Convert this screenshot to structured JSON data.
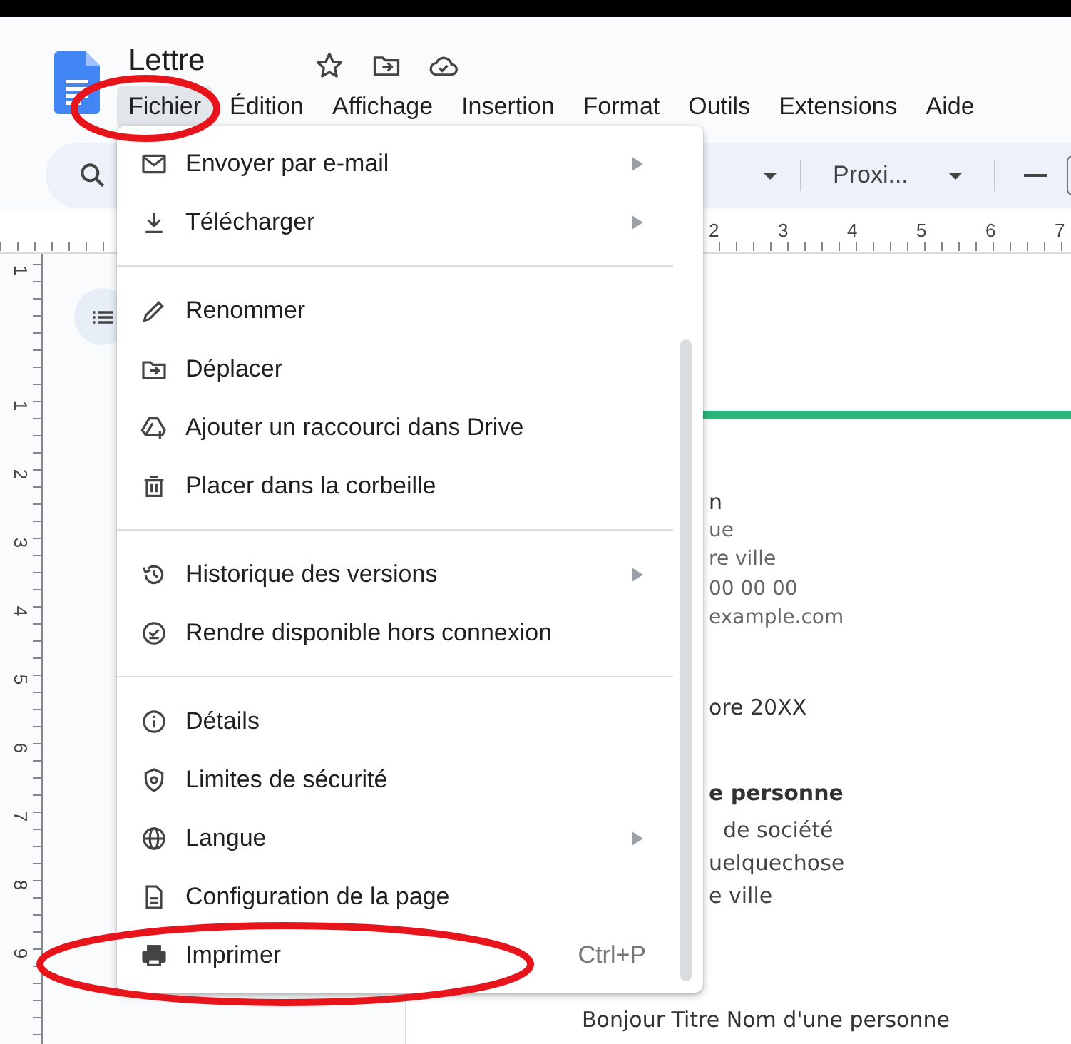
{
  "document_title": "Lettre",
  "menu_bar": [
    {
      "label": "Fichier",
      "selected": true
    },
    {
      "label": "Édition",
      "selected": false
    },
    {
      "label": "Affichage",
      "selected": false
    },
    {
      "label": "Insertion",
      "selected": false
    },
    {
      "label": "Format",
      "selected": false
    },
    {
      "label": "Outils",
      "selected": false
    },
    {
      "label": "Extensions",
      "selected": false
    },
    {
      "label": "Aide",
      "selected": false
    }
  ],
  "toolbar": {
    "font": "Proxi..."
  },
  "ruler": [
    "2",
    "3",
    "4",
    "5",
    "6",
    "7"
  ],
  "vertical_ruler": [
    "1",
    "1",
    "2",
    "3",
    "4",
    "5",
    "6",
    "7",
    "8",
    "9"
  ],
  "file_menu": [
    [
      {
        "kind": "mail",
        "label": "Envoyer par e-mail",
        "submenu": true
      },
      {
        "kind": "download",
        "label": "Télécharger",
        "submenu": true
      }
    ],
    [
      {
        "kind": "pencil",
        "label": "Renommer",
        "submenu": false
      },
      {
        "kind": "move",
        "label": "Déplacer",
        "submenu": false
      },
      {
        "kind": "shortcut",
        "label": "Ajouter un raccourci dans Drive",
        "submenu": false
      },
      {
        "kind": "trash",
        "label": "Placer dans la corbeille",
        "submenu": false
      }
    ],
    [
      {
        "kind": "history",
        "label": "Historique des versions",
        "submenu": true
      },
      {
        "kind": "offline",
        "label": "Rendre disponible hors connexion",
        "submenu": false
      }
    ],
    [
      {
        "kind": "info",
        "label": "Détails",
        "submenu": false
      },
      {
        "kind": "shield",
        "label": "Limites de sécurité",
        "submenu": false
      },
      {
        "kind": "globe",
        "label": "Langue",
        "submenu": true
      },
      {
        "kind": "page",
        "label": "Configuration de la page",
        "submenu": false
      },
      {
        "kind": "printer",
        "label": "Imprimer",
        "submenu": false,
        "shortcut": "Ctrl+P"
      }
    ]
  ],
  "document": [
    {
      "kind": "name",
      "text": "n"
    },
    {
      "kind": "contact",
      "text": "ue"
    },
    {
      "kind": "contact",
      "text": "re ville"
    },
    {
      "kind": "contact",
      "text": "00 00 00"
    },
    {
      "kind": "contact",
      "text": "example.com"
    },
    {
      "kind": "date",
      "text": "ore 20XX"
    },
    {
      "kind": "recipient",
      "text": "e personne"
    },
    {
      "kind": "address",
      "text": "de société"
    },
    {
      "kind": "address",
      "text": "uelquechose"
    },
    {
      "kind": "address",
      "text": "e ville"
    },
    {
      "kind": "salutation",
      "text": "Bonjour Titre Nom d'une personne"
    }
  ]
}
